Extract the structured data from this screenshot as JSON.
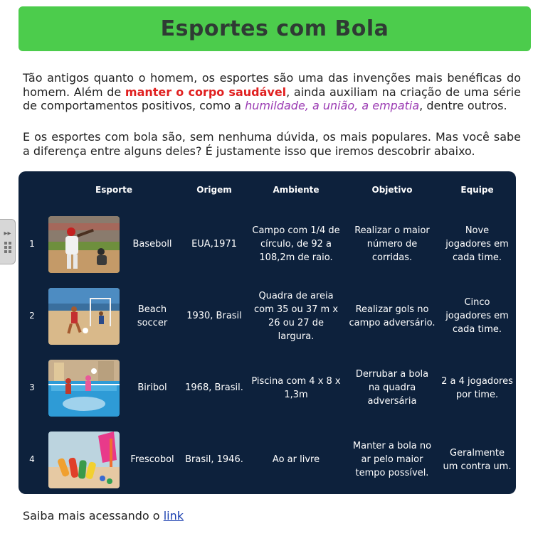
{
  "header": {
    "title": "Esportes com Bola"
  },
  "intro": {
    "p1_part1": "Tão antigos quanto o homem, os esportes são uma das invenções mais benéficas do homem. Além de ",
    "p1_highlight_red": "manter o corpo saudável",
    "p1_part2": ", ainda auxiliam na criação de uma série de comportamentos positivos, como a ",
    "p1_highlight_purple": "humildade, a união, a empatia",
    "p1_part3": ", dentre outros.",
    "p2": "E os esportes com bola são, sem nenhuma dúvida, os mais populares. Mas você sabe a diferença entre alguns deles? É justamente isso que iremos descobrir abaixo."
  },
  "table": {
    "headers": [
      "Esporte",
      "Origem",
      "Ambiente",
      "Objetivo",
      "Equipe"
    ],
    "rows": [
      {
        "num": "1",
        "image": "baseball-photo",
        "sport": "Baseboll",
        "origin": "EUA,1971",
        "environment": "Campo com 1/4 de círculo, de 92 a 108,2m de raio.",
        "objective": "Realizar o maior número de corridas.",
        "team": "Nove jogadores em cada time."
      },
      {
        "num": "2",
        "image": "beach-soccer-photo",
        "sport": "Beach soccer",
        "origin": "1930, Brasil",
        "environment": "Quadra de areia com 35 ou 37 m x 26 ou 27 de largura.",
        "objective": "Realizar gols no campo adversário.",
        "team": "Cinco jogadores em cada time."
      },
      {
        "num": "3",
        "image": "biribol-photo",
        "sport": "Biribol",
        "origin": "1968, Brasil.",
        "environment": "Piscina com 4 x 8 x 1,3m",
        "objective": "Derrubar a bola na quadra adversária",
        "team": "2 a 4 jogadores por time."
      },
      {
        "num": "4",
        "image": "frescobol-photo",
        "sport": "Frescobol",
        "origin": "Brasil, 1946.",
        "environment": "Ao ar livre",
        "objective": "Manter a bola no ar pelo maior tempo possível.",
        "team": "Geralmente um contra um."
      }
    ]
  },
  "footer": {
    "text": "Saiba mais acessando o ",
    "link_label": "link"
  },
  "colors": {
    "banner": "#4ccc4c",
    "panel": "#0d213c",
    "highlight_red": "#e02020",
    "highlight_purple": "#9b3bb3"
  }
}
